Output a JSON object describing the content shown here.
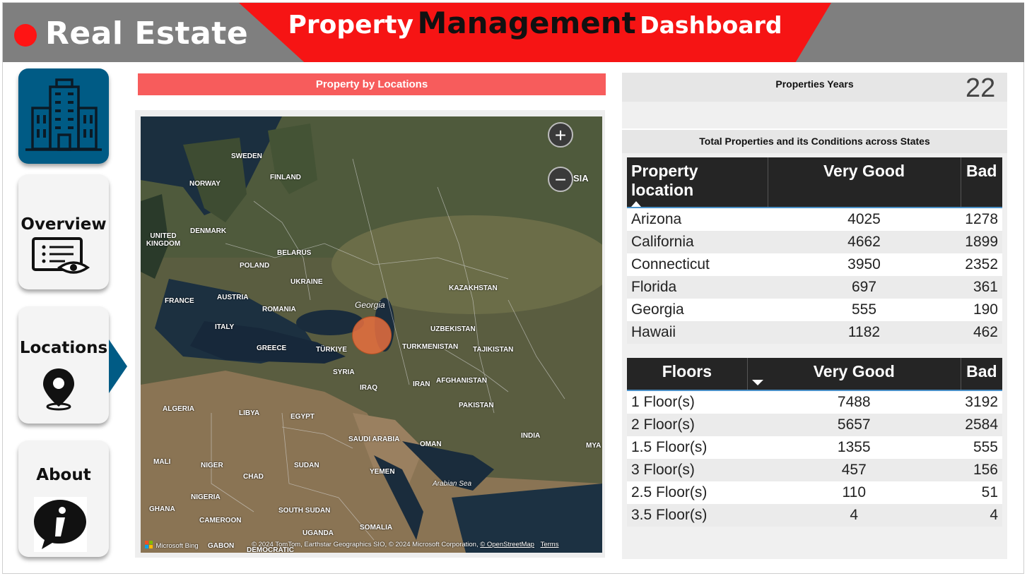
{
  "header": {
    "brand": "Real Estate",
    "title_part1": "Property",
    "title_part2": "Management",
    "title_part3": "Dashboard"
  },
  "nav": {
    "overview_label": "Overview",
    "locations_label": "Locations",
    "about_label": "About",
    "active": "Locations"
  },
  "map": {
    "title": "Property by Locations",
    "bubble_label": "Georgia",
    "zoom_in": "+",
    "zoom_out": "−",
    "provider": "Microsoft Bing",
    "attribution": "© 2024 TomTom, Earthstar Geographics SIO, © 2024 Microsoft Corporation,",
    "osm_link": "© OpenStreetMap",
    "terms_link": "Terms",
    "place_labels": [
      "SWEDEN",
      "FINLAND",
      "NORWAY",
      "RUSSIA",
      "UNITED KINGDOM",
      "DENMARK",
      "BELARUS",
      "POLAND",
      "UKRAINE",
      "KAZAKHSTAN",
      "FRANCE",
      "AUSTRIA",
      "ROMANIA",
      "ITALY",
      "UZBEKISTAN",
      "GREECE",
      "TÜRKIYE",
      "TURKMENISTAN",
      "TAJIKISTAN",
      "SYRIA",
      "IRAQ",
      "IRAN",
      "AFGHANISTAN",
      "ALGERIA",
      "LIBYA",
      "EGYPT",
      "PAKISTAN",
      "SAUDI ARABIA",
      "OMAN",
      "INDIA",
      "MALI",
      "NIGER",
      "CHAD",
      "SUDAN",
      "YEMEN",
      "Arabian Sea",
      "NIGERIA",
      "SOUTH SUDAN",
      "GHANA",
      "CAMEROON",
      "UGANDA",
      "SOMALIA",
      "GABON",
      "DEMOCRATIC",
      "MYA"
    ]
  },
  "kpi": {
    "label": "Properties Years",
    "value": "22"
  },
  "states_table": {
    "title": "Total Properties and its Conditions across States",
    "columns": [
      "Property location",
      "Very Good",
      "Bad"
    ],
    "rows": [
      [
        "Arizona",
        "4025",
        "1278"
      ],
      [
        "California",
        "4662",
        "1899"
      ],
      [
        "Connecticut",
        "3950",
        "2352"
      ],
      [
        "Florida",
        "697",
        "361"
      ],
      [
        "Georgia",
        "555",
        "190"
      ],
      [
        "Hawaii",
        "1182",
        "462"
      ]
    ]
  },
  "floors_table": {
    "columns": [
      "Floors",
      "Very Good",
      "Bad"
    ],
    "rows": [
      [
        "1 Floor(s)",
        "7488",
        "3192"
      ],
      [
        "2 Floor(s)",
        "5657",
        "2584"
      ],
      [
        "1.5 Floor(s)",
        "1355",
        "555"
      ],
      [
        "3 Floor(s)",
        "457",
        "156"
      ],
      [
        "2.5 Floor(s)",
        "110",
        "51"
      ],
      [
        "3.5 Floor(s)",
        "4",
        "4"
      ]
    ]
  },
  "colors": {
    "header_bg": "#7f7f7f",
    "banner_red": "#f61414",
    "nav_blue": "#005b85",
    "map_title_bg": "#f75c5c",
    "table_header": "#252525"
  }
}
